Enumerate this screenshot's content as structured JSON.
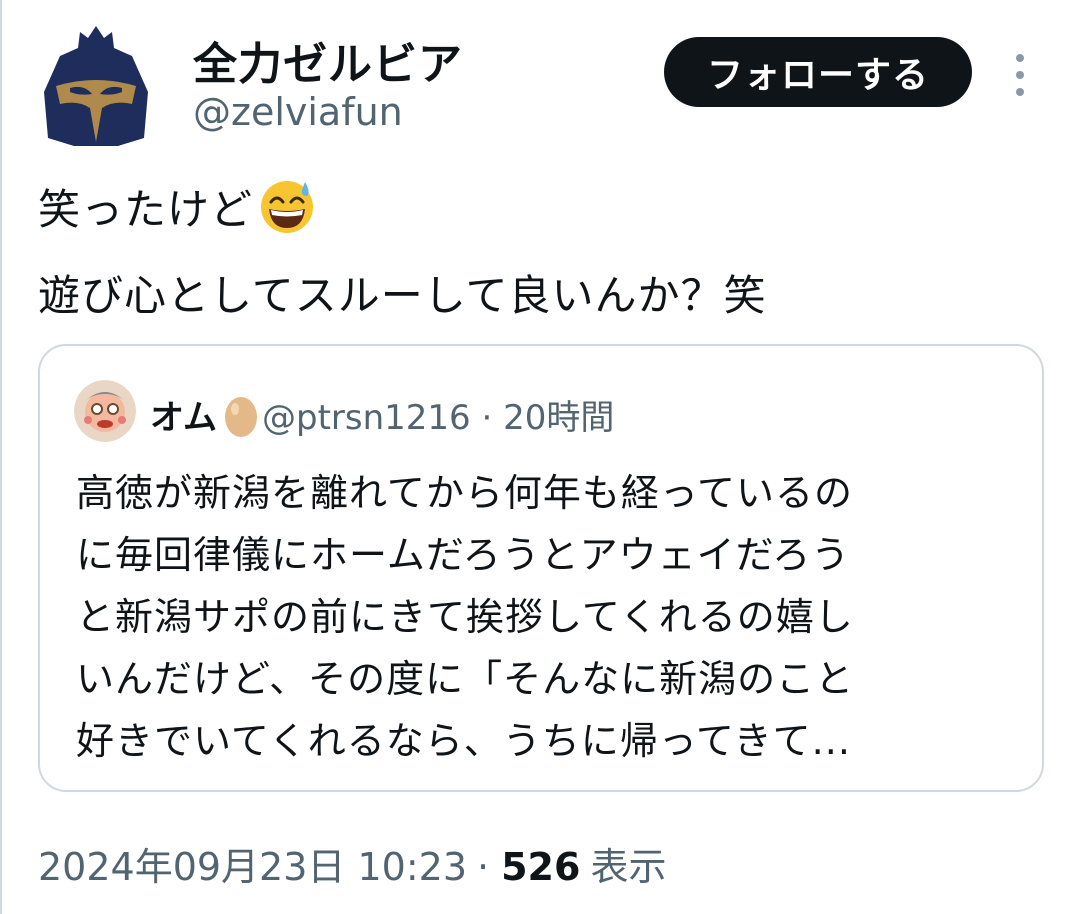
{
  "author": {
    "name": "全力ゼルビア",
    "handle": "@zelviafun"
  },
  "actions": {
    "follow_label": "フォローする"
  },
  "tweet": {
    "line1": "笑ったけど",
    "line1_emoji": "grinning-face-with-sweat-icon",
    "line2": "遊び心としてスルーして良いんか？笑"
  },
  "quoted": {
    "name": "オム",
    "name_emoji": "egg-icon",
    "handle": "@ptrsn1216",
    "separator": "·",
    "time": "20時間",
    "body_lines": [
      "高徳が新潟を離れてから何年も経っているの",
      "に毎回律儀にホームだろうとアウェイだろう",
      "と新潟サポの前にきて挨拶してくれるの嬉し",
      "いんだけど、その度に「そんなに新潟のこと",
      "好きでいてくれるなら、うちに帰ってきて..."
    ]
  },
  "meta": {
    "timestamp": "2024年09月23日 10:23",
    "separator": "·",
    "views": "526",
    "views_label": "表示"
  },
  "colors": {
    "text_primary": "#0f1419",
    "text_secondary": "#536471",
    "border": "#cfd9de",
    "button_bg": "#0f1419",
    "avatar_navy": "#1e2d5c",
    "avatar_gold": "#b08a4a"
  }
}
